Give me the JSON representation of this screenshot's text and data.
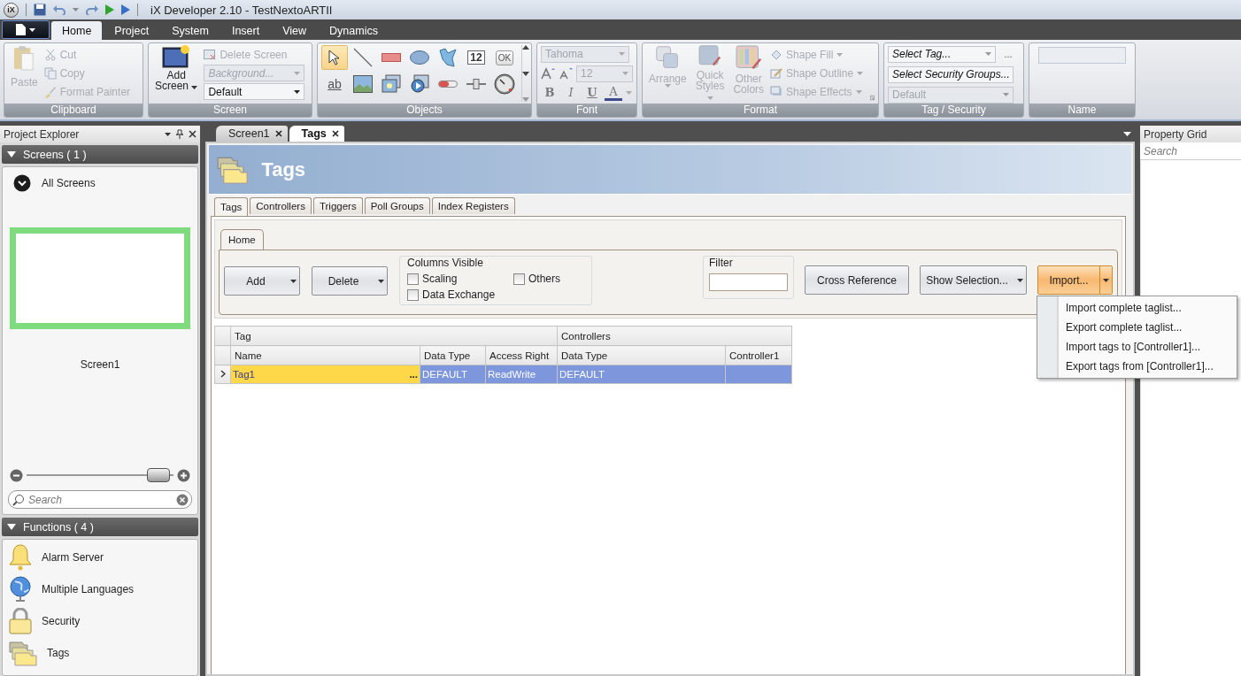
{
  "title_bar": {
    "logo": "iX",
    "title": "iX Developer 2.10 - TestNextoARTII"
  },
  "ribbon": {
    "tabs": [
      {
        "label": "Home",
        "selected": true
      },
      {
        "label": "Project",
        "selected": false
      },
      {
        "label": "System",
        "selected": false
      },
      {
        "label": "Insert",
        "selected": false
      },
      {
        "label": "View",
        "selected": false
      },
      {
        "label": "Dynamics",
        "selected": false
      }
    ],
    "groups": [
      {
        "kind": "clipboard",
        "label": "Clipboard",
        "main": {
          "label": "Paste",
          "disabled": true
        },
        "items": [
          {
            "kind": "cut",
            "label": "Cut",
            "disabled": true
          },
          {
            "kind": "copy",
            "label": "Copy",
            "disabled": true
          },
          {
            "kind": "painter",
            "label": "Format Painter",
            "disabled": true
          }
        ]
      },
      {
        "kind": "screen",
        "label": "Screen",
        "main": {
          "label": "Add",
          "label_2": "Screen",
          "disabled": false
        },
        "items": [
          {
            "kind": "button",
            "label": "Delete Screen",
            "disabled": true
          },
          {
            "kind": "combo",
            "label": "Background...",
            "disabled": true
          },
          {
            "kind": "combo",
            "label": "Default",
            "disabled": false
          }
        ]
      },
      {
        "kind": "objects",
        "label": "Objects",
        "objects": [
          {
            "kind": "pointer",
            "selected": true
          },
          {
            "kind": "line",
            "selected": false
          },
          {
            "kind": "rectangle",
            "selected": false
          },
          {
            "kind": "ellipse",
            "selected": false
          },
          {
            "kind": "polygon",
            "selected": false
          },
          {
            "kind": "numeric",
            "glyph": "12",
            "selected": false
          },
          {
            "kind": "button",
            "glyph": "OK",
            "selected": false
          },
          {
            "kind": "text",
            "glyph": "ab",
            "selected": false
          },
          {
            "kind": "image",
            "selected": false
          },
          {
            "kind": "animation",
            "selected": false
          },
          {
            "kind": "media",
            "selected": false
          },
          {
            "kind": "bar",
            "selected": false
          },
          {
            "kind": "slider",
            "selected": false
          },
          {
            "kind": "gauge",
            "selected": false
          }
        ]
      },
      {
        "kind": "font",
        "label": "Font",
        "disabled": true,
        "font": "Tahoma",
        "size": "12",
        "styles": [
          {
            "kind": "bold",
            "glyph": "B"
          },
          {
            "kind": "italic",
            "glyph": "I"
          },
          {
            "kind": "underline",
            "glyph": "U"
          },
          {
            "kind": "color",
            "glyph": "A"
          }
        ]
      },
      {
        "kind": "format",
        "label": "Format",
        "disabled": true,
        "main": [
          {
            "kind": "arrange",
            "label": "Arrange"
          },
          {
            "kind": "styles",
            "label": "Quick",
            "label_2": "Styles"
          },
          {
            "kind": "colors",
            "label": "Other",
            "label_2": "Colors"
          }
        ],
        "items": [
          {
            "kind": "fill",
            "label": "Shape Fill"
          },
          {
            "kind": "outline",
            "label": "Shape Outline"
          },
          {
            "kind": "effects",
            "label": "Shape Effects"
          }
        ]
      },
      {
        "kind": "tag_security",
        "label": "Tag / Security",
        "more": "...",
        "items": [
          {
            "label": "Select Tag...",
            "disabled": false
          },
          {
            "label": "Select Security Groups...",
            "disabled": false
          },
          {
            "label": "Default",
            "disabled": true
          }
        ]
      },
      {
        "kind": "name",
        "label": "Name"
      }
    ]
  },
  "project_explorer": {
    "title": "Project Explorer",
    "sections": [
      {
        "kind": "screens",
        "title": "Screens ( 1 )",
        "expanded": true,
        "filter": "All Screens",
        "screens": [
          {
            "label": "Screen1",
            "selected": true
          }
        ],
        "zoom": {
          "level": 0.9
        },
        "search": {
          "placeholder": "Search"
        }
      },
      {
        "kind": "functions",
        "title": "Functions ( 4 )",
        "expanded": true,
        "items": [
          {
            "kind": "alarm",
            "label": "Alarm Server"
          },
          {
            "kind": "languages",
            "label": "Multiple Languages"
          },
          {
            "kind": "security",
            "label": "Security"
          },
          {
            "kind": "tags",
            "label": "Tags"
          }
        ]
      }
    ]
  },
  "document": {
    "tabs": [
      {
        "label": "Screen1",
        "selected": false
      },
      {
        "label": "Tags",
        "selected": true
      }
    ],
    "header": "Tags",
    "subtabs": [
      {
        "label": "Tags",
        "selected": true
      },
      {
        "label": "Controllers",
        "selected": false
      },
      {
        "label": "Triggers",
        "selected": false
      },
      {
        "label": "Poll Groups",
        "selected": false
      },
      {
        "label": "Index Registers",
        "selected": false
      }
    ],
    "ribbon_tab": {
      "label": "Home",
      "selected": true
    },
    "buttons_left": [
      {
        "label": "Add",
        "split": true
      },
      {
        "label": "Delete",
        "split": true
      }
    ],
    "columns_visible": {
      "title": "Columns Visible",
      "options": [
        {
          "label": "Scaling",
          "checked": false
        },
        {
          "label": "Others",
          "checked": false
        },
        {
          "label": "Data Exchange",
          "checked": false
        }
      ]
    },
    "filter": {
      "title": "Filter"
    },
    "buttons_right": [
      {
        "label": "Cross Reference",
        "split": false,
        "active": false
      },
      {
        "label": "Show Selection...",
        "split": true,
        "active": false
      },
      {
        "label": "Import...",
        "split": true,
        "active": true,
        "menu": [
          "Import complete taglist...",
          "Export complete taglist...",
          "Import tags to [Controller1]...",
          "Export tags from [Controller1]..."
        ]
      }
    ],
    "grid": {
      "groups": [
        {
          "label": "Tag",
          "columns": [
            "Name",
            "Data Type",
            "Access Right"
          ]
        },
        {
          "label": "Controllers",
          "columns": [
            "Data Type",
            "Controller1"
          ]
        }
      ],
      "rows": [
        {
          "selected": true,
          "current": true,
          "ellipsis": "...",
          "cells": [
            {
              "text": "Tag1",
              "focused": true
            },
            {
              "text": "DEFAULT",
              "focused": false
            },
            {
              "text": "ReadWrite",
              "focused": false
            },
            {
              "text": "DEFAULT",
              "focused": false
            },
            {
              "focused": false
            }
          ]
        }
      ]
    }
  },
  "property_grid": {
    "title": "Property Grid",
    "search": {
      "placeholder": "Search"
    }
  }
}
